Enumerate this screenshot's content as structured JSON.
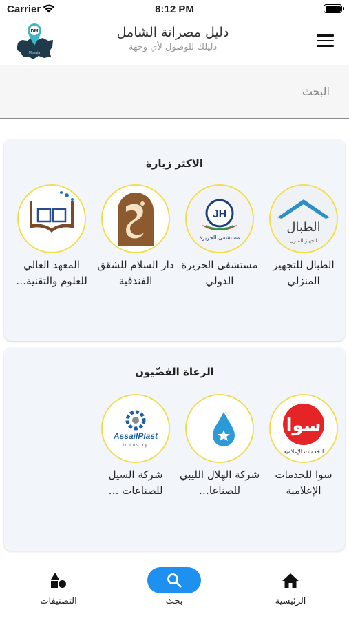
{
  "status_bar": {
    "carrier": "Carrier",
    "time": "8:12 PM"
  },
  "header": {
    "title": "دليل مصراتة الشامل",
    "subtitle": "دليلك للوصول لأي وجهة",
    "logo": {
      "initials": "DM",
      "caption": "Misrata"
    }
  },
  "search": {
    "placeholder": "البحث",
    "value": ""
  },
  "sections": [
    {
      "title": "الاكثر زيارة",
      "items": [
        {
          "name": "الطبال للتجهيز المنزلي",
          "logo_text": "الطبال",
          "logo_subtext": "لتجهيز المنزل"
        },
        {
          "name": "مستشفى الجزيرة الدولي",
          "logo_text": "JH",
          "logo_subtext": "مستشفى الجزيرة"
        },
        {
          "name": "دار السلام للشقق الفندقية",
          "logo_text": ""
        },
        {
          "name": "المعهد العالي للعلوم والتقنية…",
          "logo_text": ""
        }
      ]
    },
    {
      "title": "الرعاة الفضّيون",
      "items": [
        {
          "name": "سوا للخدمات الإعلامية",
          "logo_text": "سوا",
          "logo_subtext": "للخدمات الإعلامية"
        },
        {
          "name": "شركة الهلال الليبي للصناعا…",
          "logo_text": ""
        },
        {
          "name": "شركة السيل للصناعات …",
          "logo_text": "AssailPlast",
          "logo_subtext": "Industry"
        }
      ]
    }
  ],
  "bottom_nav": [
    {
      "label": "الرئيسية",
      "icon": "home-icon"
    },
    {
      "label": "بحث",
      "icon": "search-icon"
    },
    {
      "label": "التصنيفات",
      "icon": "categories-icon"
    }
  ],
  "colors": {
    "accent": "#1e90f0",
    "ring": "#f2dd4a",
    "card_bg": "#f2f6fa"
  }
}
